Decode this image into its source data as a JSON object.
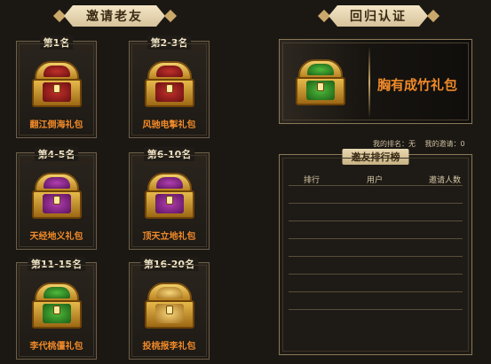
{
  "sections": {
    "invite_title": "邀请老友",
    "return_title": "回归认证"
  },
  "rewards": [
    {
      "rank": "第1名",
      "gift": "翻江倒海礼包",
      "inlay": "red",
      "lid": "red"
    },
    {
      "rank": "第2-3名",
      "gift": "风驰电掣礼包",
      "inlay": "red",
      "lid": "red"
    },
    {
      "rank": "第4-5名",
      "gift": "天经地义礼包",
      "inlay": "purple",
      "lid": "purple"
    },
    {
      "rank": "第6-10名",
      "gift": "顶天立地礼包",
      "inlay": "purple",
      "lid": "purple"
    },
    {
      "rank": "第11-15名",
      "gift": "李代桃僵礼包",
      "inlay": "green",
      "lid": "green"
    },
    {
      "rank": "第16-20名",
      "gift": "投桃报李礼包",
      "inlay": "gold",
      "lid": "gold"
    }
  ],
  "return_reward": {
    "gift": "胸有成竹礼包",
    "inlay": "green"
  },
  "stats": {
    "my_rank": "我的排名：无",
    "my_invites": "我的邀请：0"
  },
  "leaderboard": {
    "title": "邀友排行榜",
    "columns": [
      "排行",
      "用户",
      "邀请人数"
    ],
    "rows": []
  },
  "colors": {
    "accent_orange": "#f08a2a",
    "frame_gold": "#8a7856",
    "background": "#1b1814"
  }
}
